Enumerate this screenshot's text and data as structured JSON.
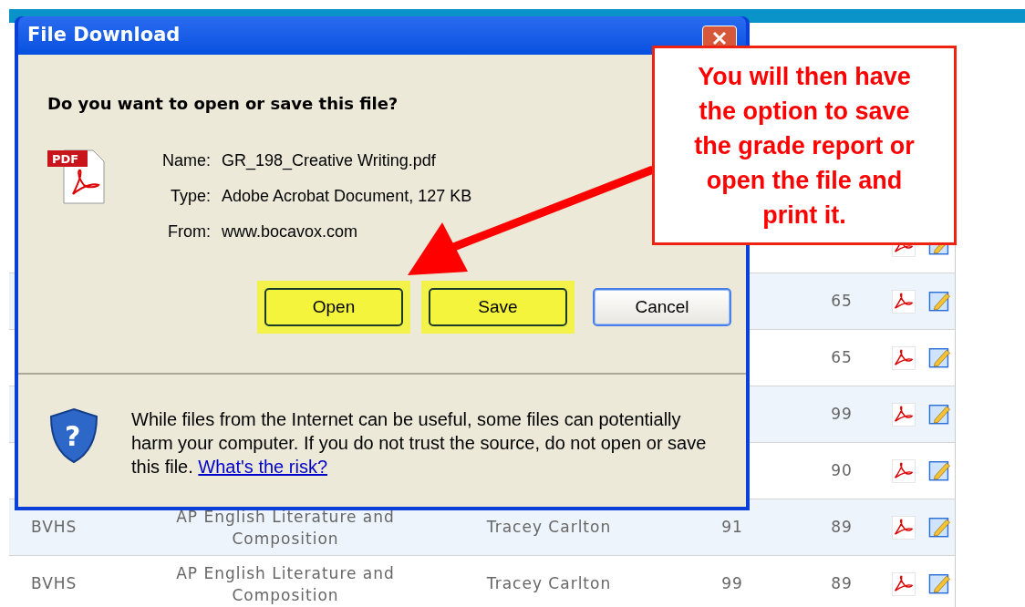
{
  "page": {
    "rows": [
      {},
      {
        "score_2": "65"
      },
      {
        "score_2": "65"
      },
      {
        "score_2": "99"
      },
      {
        "score_2": "90"
      },
      {
        "school": "BVHS",
        "course": "AP English Literature and Composition",
        "teacher": "Tracey Carlton",
        "score_1": "91",
        "score_2": "89"
      },
      {
        "school": "BVHS",
        "course": "AP English Literature and Composition",
        "teacher": "Tracey Carlton",
        "score_1": "99",
        "score_2": "89"
      }
    ]
  },
  "dialog": {
    "title": "File Download",
    "question": "Do you want to open or save this file?",
    "file_icon_label": "PDF",
    "help_icon_glyph": "?",
    "file_fields": [
      {
        "label": "Name:",
        "value": "GR_198_Creative Writing.pdf"
      },
      {
        "label": "Type:",
        "value": "Adobe Acrobat Document, 127 KB"
      },
      {
        "label": "From:",
        "value": "www.bocavox.com"
      }
    ],
    "buttons": [
      {
        "label": "Open",
        "highlighted": true,
        "default": false
      },
      {
        "label": "Save",
        "highlighted": true,
        "default": false
      },
      {
        "label": "Cancel",
        "highlighted": false,
        "default": true
      }
    ],
    "warning": {
      "text": "While files from the Internet can be useful, some files can potentially harm your computer. If you do not trust the source, do not open or save this file.",
      "link": "What's the risk?"
    }
  },
  "callout": {
    "text": "You will then have the option to save the grade report or open the file and print it."
  }
}
